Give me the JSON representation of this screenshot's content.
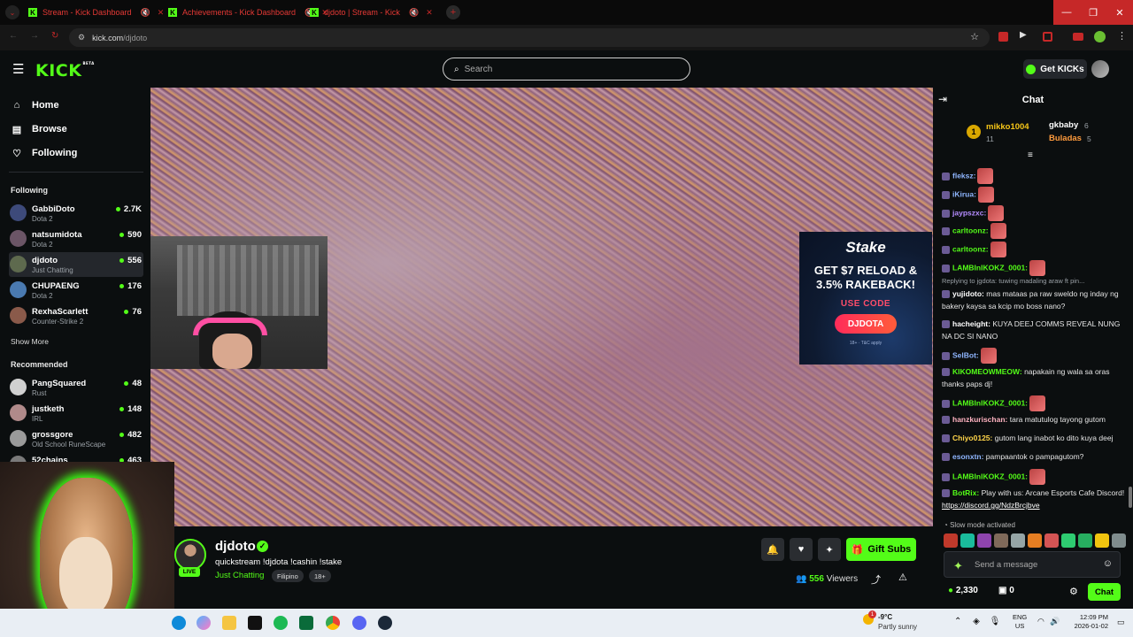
{
  "browser": {
    "tabs": [
      {
        "label": "Stream - Kick Dashboard"
      },
      {
        "label": "Achievements - Kick Dashboard"
      },
      {
        "label": "djdoto | Stream - Kick"
      }
    ],
    "url_host": "kick.com",
    "url_path": "/djdoto",
    "window_controls": {
      "minimize": "—",
      "restore": "❐",
      "close": "✕"
    }
  },
  "header": {
    "logo": "KICK",
    "logo_badge": "BETA",
    "search_placeholder": "Search",
    "get_kicks": "Get KICKs"
  },
  "sidebar": {
    "nav": [
      {
        "label": "Home",
        "icon": "home-icon"
      },
      {
        "label": "Browse",
        "icon": "browse-icon"
      },
      {
        "label": "Following",
        "icon": "heart-icon"
      }
    ],
    "following_title": "Following",
    "following": [
      {
        "name": "GabbiDoto",
        "category": "Dota 2",
        "viewers": "2.7K",
        "color": "#3d4a7a"
      },
      {
        "name": "natsumidota",
        "category": "Dota 2",
        "viewers": "590",
        "color": "#6b5566"
      },
      {
        "name": "djdoto",
        "category": "Just Chatting",
        "viewers": "556",
        "color": "#5e6a4e"
      },
      {
        "name": "CHUPAENG",
        "category": "Dota 2",
        "viewers": "176",
        "color": "#4a7ab0"
      },
      {
        "name": "RexhaScarlett",
        "category": "Counter-Strike 2",
        "viewers": "76",
        "color": "#8a5a4a"
      }
    ],
    "show_more": "Show More",
    "recommended_title": "Recommended",
    "recommended": [
      {
        "name": "PangSquared",
        "category": "Rust",
        "viewers": "48",
        "color": "#d0d0d0"
      },
      {
        "name": "justketh",
        "category": "IRL",
        "viewers": "148",
        "color": "#b08a8a"
      },
      {
        "name": "grossgore",
        "category": "Old School RuneScape",
        "viewers": "482",
        "color": "#9a9a9a"
      },
      {
        "name": "52chains",
        "category": "",
        "viewers": "463",
        "color": "#7a7a7a"
      }
    ]
  },
  "ad": {
    "brand": "Stake",
    "line1": "GET $7 RELOAD &",
    "line2": "3.5% RAKEBACK!",
    "use_code": "USE CODE",
    "code": "DJDOTA",
    "terms": "18+ · T&C apply"
  },
  "channel": {
    "name": "djdoto",
    "live": "LIVE",
    "title": "quickstream !djdota !cashin !stake",
    "category": "Just Chatting",
    "tags": [
      "Filipino",
      "18+"
    ],
    "gift_subs": "Gift Subs",
    "viewers": "556",
    "viewers_label": "Viewers"
  },
  "chat": {
    "title": "Chat",
    "leaderboard": [
      {
        "rank": "1",
        "name": "mikko1004",
        "count": "11",
        "color": "#f5c518"
      },
      {
        "name": "gkbaby",
        "count": "6",
        "color": "#ffffff"
      },
      {
        "name": "Buladas",
        "count": "5",
        "color": "#ff9b3d"
      }
    ],
    "messages": [
      {
        "user": "fleksz:",
        "text": "",
        "color": "#8fb6ff",
        "emote": true
      },
      {
        "user": "iKirua:",
        "text": "",
        "color": "#8fb6ff",
        "emote": true
      },
      {
        "user": "jaypszxc:",
        "text": "",
        "color": "#b58cff",
        "emote": true
      },
      {
        "user": "carltoonz:",
        "text": "",
        "color": "#53fc18",
        "emote": true
      },
      {
        "user": "carltoonz:",
        "text": "",
        "color": "#53fc18",
        "emote": true
      },
      {
        "user": "LAMBInIKOKZ_0001:",
        "text": "",
        "color": "#53fc18",
        "emote": true
      },
      {
        "reply": "Replying to jgdota: tuwing madaling araw ft pin..."
      },
      {
        "user": "yujidoto:",
        "text": "mas mataas pa raw sweldo ng inday ng bakery kaysa sa kcip mo boss nano?",
        "color": "#ffffff"
      },
      {
        "user": "hacheight:",
        "text": "KUYA DEEJ COMMS REVEAL NUNG NA DC SI NANO",
        "color": "#ffffff"
      },
      {
        "user": "SelBot:",
        "text": "",
        "color": "#8fb6ff",
        "emote": true
      },
      {
        "user": "KIKOMEOWMEOW:",
        "text": "napakain ng wala sa oras thanks paps dj!",
        "color": "#53fc18"
      },
      {
        "user": "LAMBInIKOKZ_0001:",
        "text": "",
        "color": "#53fc18",
        "emote": true
      },
      {
        "user": "hanzkurischan:",
        "text": "tara matutulog tayong gutom",
        "color": "#ffb3c1"
      },
      {
        "user": "Chiyo0125:",
        "text": "gutom lang inabot ko dito kuya deej",
        "color": "#ffd54a"
      },
      {
        "user": "esonxtn:",
        "text": "pampaantok o pampagutom?",
        "color": "#8fb6ff"
      },
      {
        "user": "LAMBInIKOKZ_0001:",
        "text": "",
        "color": "#53fc18",
        "emote": true
      },
      {
        "user": "BotRix:",
        "text": "Play with us: Arcane Esports Cafe Discord!",
        "link": "https://discord.gg/NdzBrcjbve",
        "color": "#53fc18"
      }
    ],
    "slow_mode": "Slow mode activated",
    "send_placeholder": "Send a message",
    "points": "2,330",
    "gifts": "0",
    "chat_button": "Chat"
  },
  "taskbar": {
    "weather_temp": "-9°C",
    "weather_desc": "Partly sunny",
    "weather_badge": "1",
    "lang1": "ENG",
    "lang2": "US",
    "time": "12:09 PM",
    "date": "2026-01-02"
  }
}
